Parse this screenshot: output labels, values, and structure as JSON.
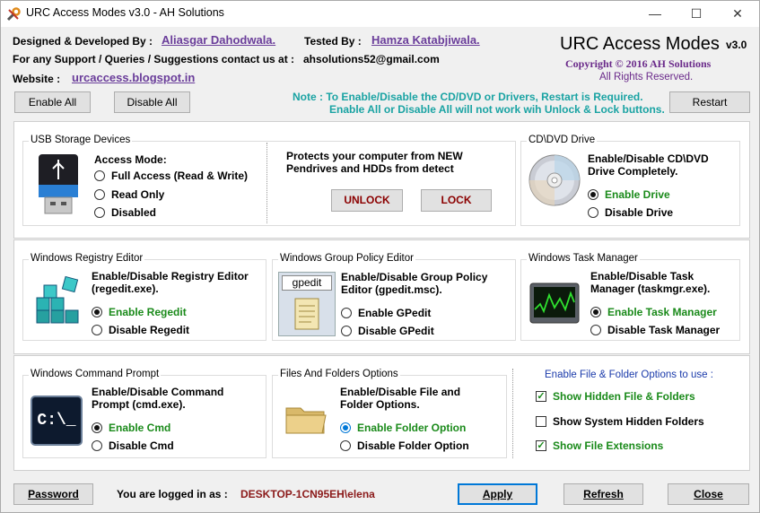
{
  "window": {
    "title": "URC Access Modes v3.0 - AH Solutions",
    "minimize": "—",
    "maximize": "☐",
    "close": "✕"
  },
  "header": {
    "designed_label": "Designed & Developed By :",
    "designer": "Aliasgar Dahodwala.",
    "tested_label": "Tested By :",
    "tester": "Hamza Katabjiwala.",
    "support_label": "For any Support / Queries / Suggestions contact us at :",
    "email": "ahsolutions52@gmail.com",
    "website_label": "Website :",
    "website": "urcaccess.blogspot.in",
    "app_name": "URC Access Modes",
    "version": "v3.0",
    "copyright": "Copyright © 2016 AH Solutions",
    "rights": "All Rights Reserved."
  },
  "toolbar": {
    "enable_all": "Enable All",
    "disable_all": "Disable All",
    "note_line1": "Note : To Enable/Disable the CD/DVD or Drivers, Restart is Required.",
    "note_line2": "Enable All or Disable All will not work wih Unlock & Lock buttons.",
    "restart": "Restart"
  },
  "usb": {
    "title": "USB Storage Devices",
    "mode_label": "Access Mode:",
    "options": [
      "Full Access (Read & Write)",
      "Read Only",
      "Disabled"
    ],
    "protect_text": "Protects your computer from NEW Pendrives and HDDs from detect",
    "unlock": "UNLOCK",
    "lock": "LOCK"
  },
  "cddvd": {
    "title": "CD\\DVD Drive",
    "desc": "Enable/Disable CD\\DVD Drive Completely.",
    "enable": "Enable Drive",
    "disable": "Disable Drive"
  },
  "registry": {
    "title": "Windows Registry Editor",
    "desc": "Enable/Disable Registry Editor (regedit.exe).",
    "enable": "Enable Regedit",
    "disable": "Disable Regedit"
  },
  "gpedit": {
    "title": "Windows Group Policy Editor",
    "icon_label": "gpedit",
    "desc": "Enable/Disable Group Policy Editor (gpedit.msc).",
    "enable": "Enable GPedit",
    "disable": "Disable GPedit"
  },
  "taskmgr": {
    "title": "Windows Task Manager",
    "desc": "Enable/Disable Task Manager (taskmgr.exe).",
    "enable": "Enable Task Manager",
    "disable": "Disable Task Manager"
  },
  "cmd": {
    "title": "Windows Command Prompt",
    "icon_label": "C:\\_",
    "desc": "Enable/Disable Command Prompt (cmd.exe).",
    "enable": "Enable Cmd",
    "disable": "Disable Cmd"
  },
  "folders": {
    "title": "Files And Folders Options",
    "desc": "Enable/Disable File and Folder Options.",
    "enable": "Enable Folder Option",
    "disable": "Disable Folder Option",
    "options_title": "Enable File & Folder Options to use :",
    "show_hidden": "Show Hidden File & Folders",
    "show_system": "Show System Hidden Folders",
    "show_ext": "Show File Extensions"
  },
  "footer": {
    "password": "Password",
    "logged_label": "You are logged in as :",
    "user": "DESKTOP-1CN95EH\\elena",
    "apply": "Apply",
    "refresh": "Refresh",
    "close": "Close"
  },
  "colors": {
    "accent_green": "#1a8a1a",
    "note_teal": "#1aa3a3",
    "link_purple": "#6a3d9a",
    "danger_red": "#8b0000"
  }
}
